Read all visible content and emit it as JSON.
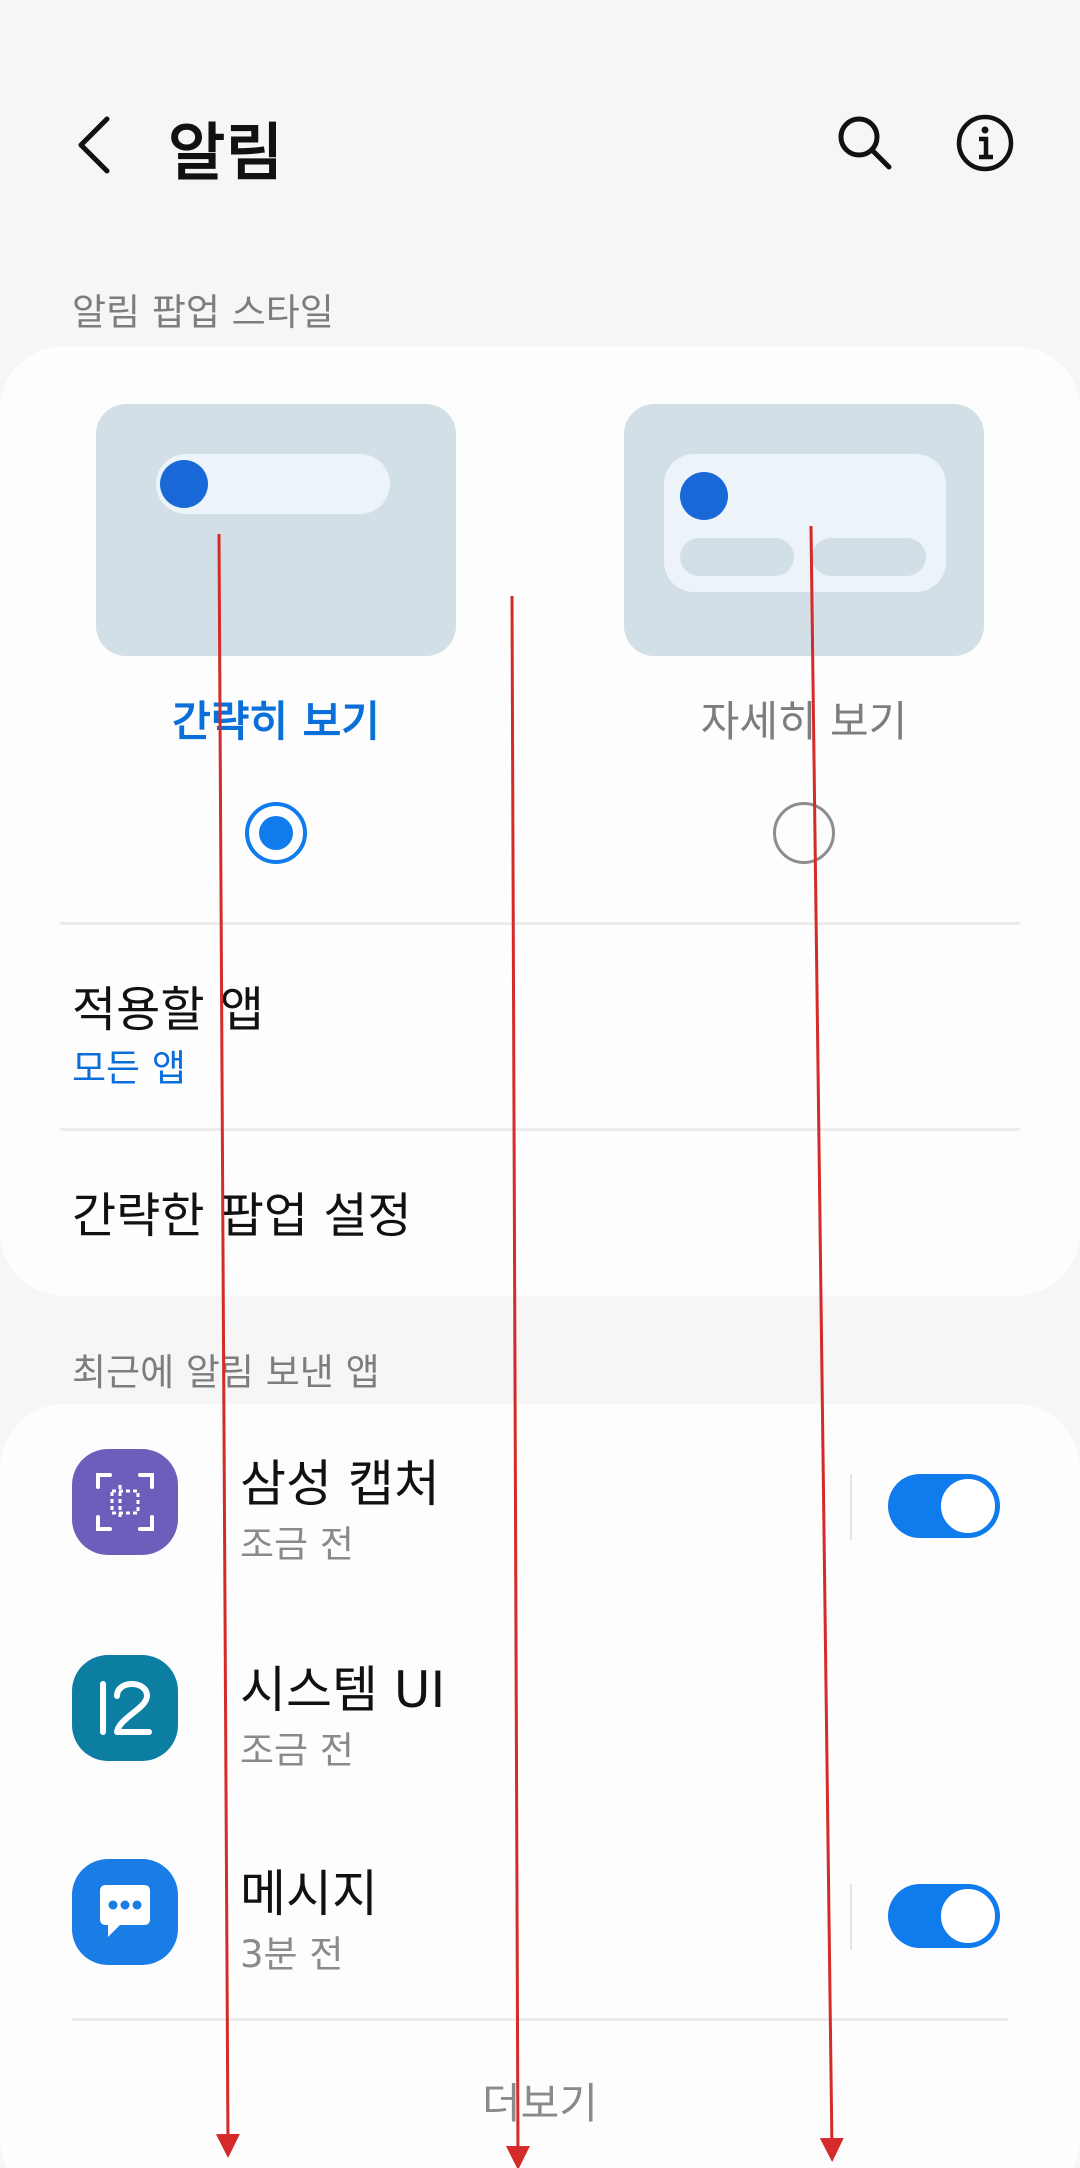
{
  "header": {
    "title": "알림"
  },
  "popup_section": {
    "label": "알림 팝업 스타일",
    "options": [
      {
        "label": "간략히 보기",
        "selected": true
      },
      {
        "label": "자세히 보기",
        "selected": false
      }
    ]
  },
  "rows": {
    "apply_apps": {
      "title": "적용할 앱",
      "value": "모든 앱"
    },
    "simple_popup_settings": {
      "title": "간략한 팝업 설정"
    }
  },
  "recent_section": {
    "label": "최근에 알림 보낸 앱",
    "apps": [
      {
        "name": "삼성 캡처",
        "time": "조금 전",
        "icon": "samsung-capture-icon",
        "toggle": true
      },
      {
        "name": "시스템 UI",
        "time": "조금 전",
        "icon": "system-ui-icon",
        "toggle": null
      },
      {
        "name": "메시지",
        "time": "3분 전",
        "icon": "messages-icon",
        "toggle": true
      }
    ],
    "more_label": "더보기"
  },
  "colors": {
    "accent": "#0f7bec",
    "selected_label": "#0a6fd8",
    "annotation_arrow": "#d42a2a"
  }
}
